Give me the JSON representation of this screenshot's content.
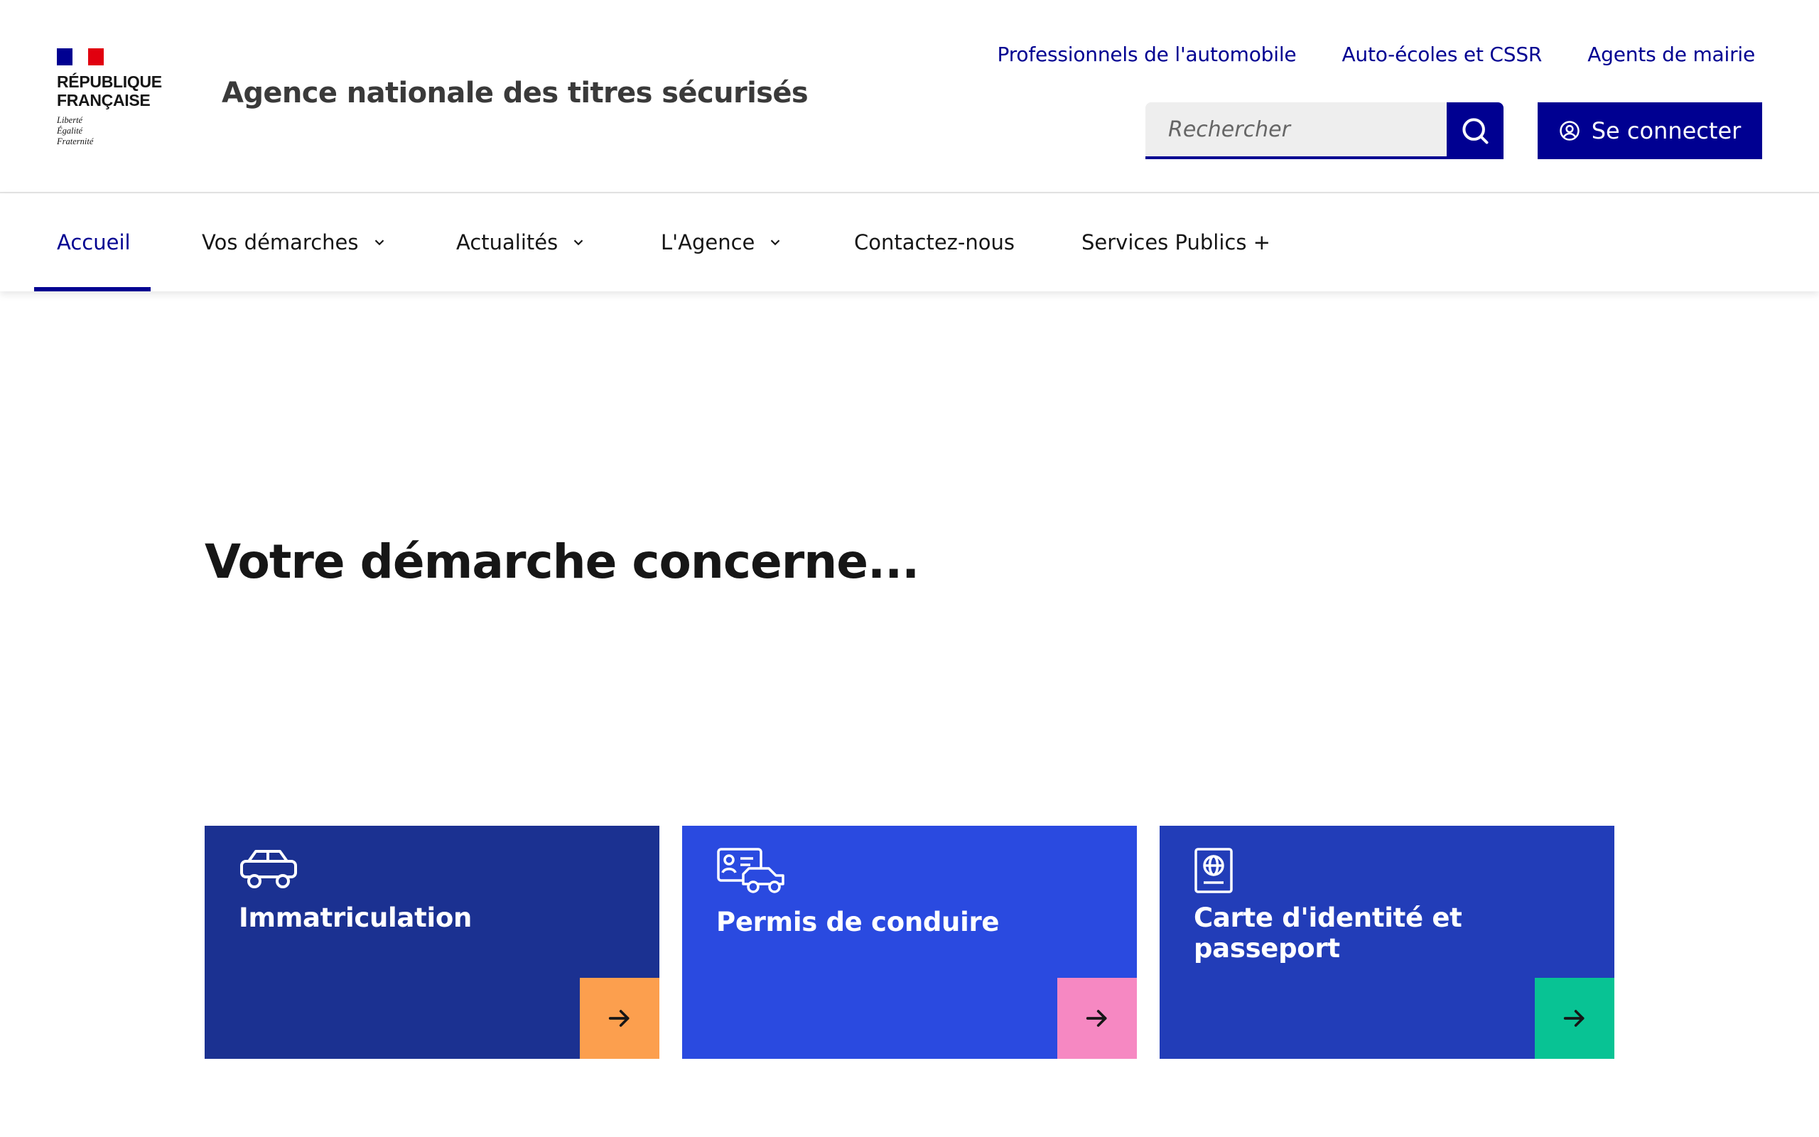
{
  "header": {
    "republic_name": [
      "RÉPUBLIQUE",
      "FRANÇAISE"
    ],
    "motto": [
      "Liberté",
      "Égalité",
      "Fraternité"
    ],
    "service_title": "Agence nationale des titres sécurisés",
    "top_links": [
      "Professionnels de l'automobile",
      "Auto-écoles et CSSR",
      "Agents de mairie"
    ],
    "search": {
      "placeholder": "Rechercher",
      "icon": "search-icon"
    },
    "login_label": "Se connecter",
    "login_icon": "user-circle-icon",
    "brand_color": "#000091"
  },
  "nav": {
    "items": [
      {
        "label": "Accueil",
        "active": true,
        "dropdown": false
      },
      {
        "label": "Vos démarches",
        "active": false,
        "dropdown": true
      },
      {
        "label": "Actualités",
        "active": false,
        "dropdown": true
      },
      {
        "label": "L'Agence",
        "active": false,
        "dropdown": true
      },
      {
        "label": "Contactez-nous",
        "active": false,
        "dropdown": false
      },
      {
        "label": "Services Publics +",
        "active": false,
        "dropdown": false
      }
    ]
  },
  "main": {
    "heading": "Votre démarche concerne...",
    "tiles": [
      {
        "title": "Immatriculation",
        "icon": "car-icon",
        "bg": "#1b3191",
        "arrow_bg": "#fc9f4e"
      },
      {
        "title": "Permis de conduire",
        "icon": "driving-license-icon",
        "bg": "#2a4ae0",
        "arrow_bg": "#f688c2"
      },
      {
        "title": "Carte d'identité et passeport",
        "icon": "passport-icon",
        "bg": "#223db8",
        "arrow_bg": "#08c394"
      }
    ]
  }
}
